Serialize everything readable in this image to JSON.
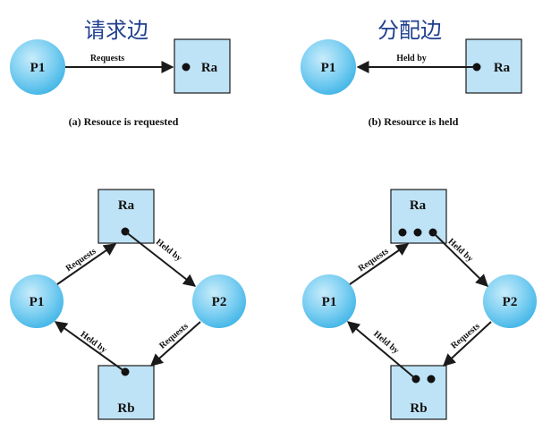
{
  "top_left": {
    "heading": "请求边",
    "process": "P1",
    "resource": "Ra",
    "edge_label": "Requests",
    "caption": "(a) Resouce is requested"
  },
  "top_right": {
    "heading": "分配边",
    "process": "P1",
    "resource": "Ra",
    "edge_label": "Held by",
    "caption": "(b) Resource is held"
  },
  "bottom_left": {
    "resource_top": "Ra",
    "resource_bottom": "Rb",
    "process_left": "P1",
    "process_right": "P2",
    "edge_p1_ra": "Requests",
    "edge_ra_p2": "Held by",
    "edge_p2_rb": "Requests",
    "edge_rb_p1": "Held by"
  },
  "bottom_right": {
    "resource_top": "Ra",
    "resource_bottom": "Rb",
    "process_left": "P1",
    "process_right": "P2",
    "edge_p1_ra": "Requests",
    "edge_ra_p2": "Held by",
    "edge_p2_rb": "Requests",
    "edge_rb_p1": "Held by"
  }
}
